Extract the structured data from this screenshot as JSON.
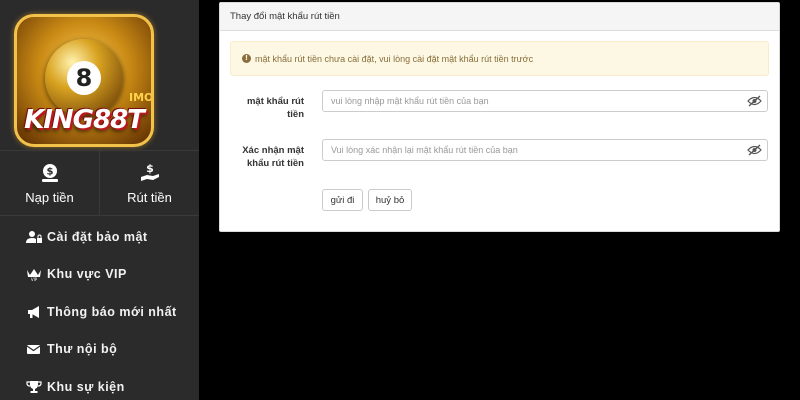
{
  "logo": {
    "text": "KING88T",
    "ball_number": "8",
    "badge": "IMO"
  },
  "actions": [
    {
      "label": "Nạp tiền",
      "icon": "deposit-icon"
    },
    {
      "label": "Rút tiền",
      "icon": "withdraw-icon"
    }
  ],
  "menu": [
    {
      "label": "Cài đặt bảo mật",
      "icon": "user-lock-icon"
    },
    {
      "label": "Khu vực VIP",
      "icon": "vip-crown-icon"
    },
    {
      "label": "Thông báo mới nhất",
      "icon": "megaphone-icon"
    },
    {
      "label": "Thư nội bộ",
      "icon": "envelope-icon"
    },
    {
      "label": "Khu sự kiện",
      "icon": "trophy-icon"
    }
  ],
  "panel": {
    "title": "Thay đổi mật khẩu rút tiền",
    "alert": "mật khẩu rút tiền chưa cài đặt, vui lòng cài đặt mật khẩu rút tiền trước",
    "fields": [
      {
        "label": "mật khẩu rút tiền",
        "value": "",
        "placeholder": "vui lòng nhập mật khẩu rút tiền của bạn"
      },
      {
        "label": "Xác nhận mật khẩu rút tiền",
        "value": "",
        "placeholder": "Vui lòng xác nhận lại mật khẩu rút tiền của bạn"
      }
    ],
    "submit_label": "gửi đi",
    "cancel_label": "huỷ bỏ"
  },
  "colors": {
    "sidebar_bg": "#2b2b2b",
    "page_bg": "#000000",
    "alert_bg": "#fcf8e3",
    "alert_text": "#8a6d3b"
  }
}
